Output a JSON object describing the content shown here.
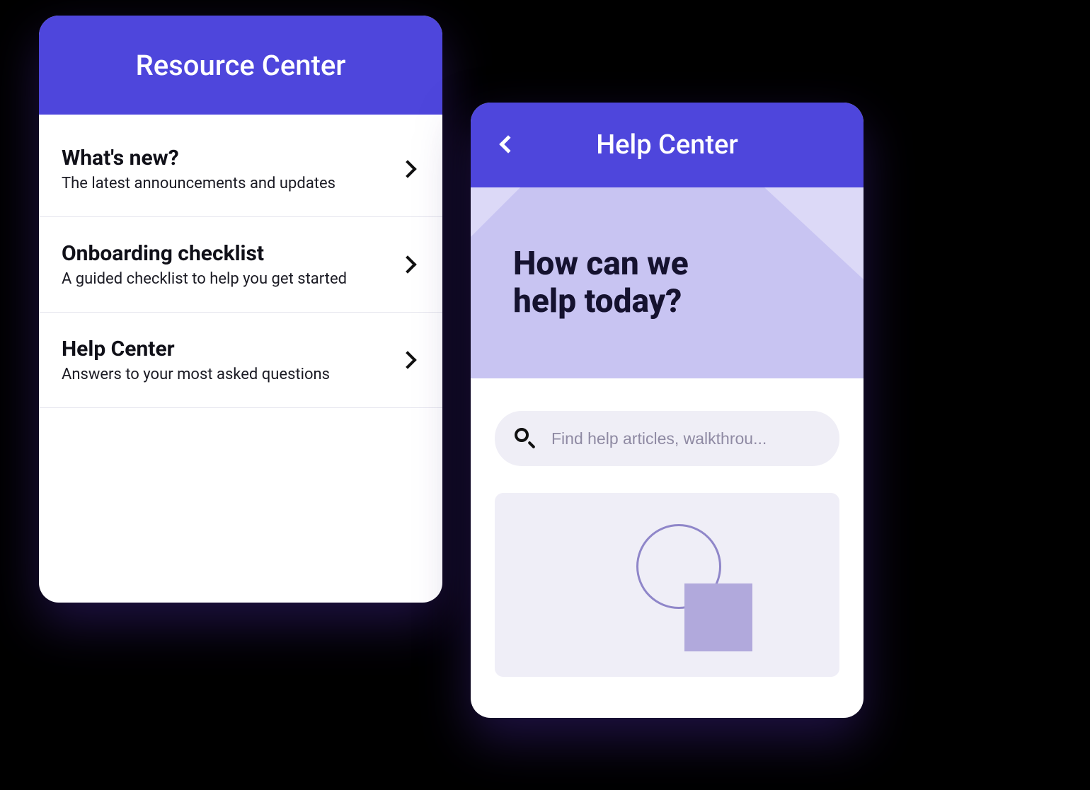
{
  "resource_center": {
    "title": "Resource Center",
    "items": [
      {
        "title": "What's new?",
        "subtitle": "The latest announcements and updates"
      },
      {
        "title": "Onboarding checklist",
        "subtitle": "A guided checklist to help you get started"
      },
      {
        "title": "Help Center",
        "subtitle": "Answers to your most asked questions"
      }
    ]
  },
  "help_center": {
    "title": "Help Center",
    "hero_line1": "How can we",
    "hero_line2": "help today?",
    "search_placeholder": "Find help articles, walkthrou..."
  }
}
